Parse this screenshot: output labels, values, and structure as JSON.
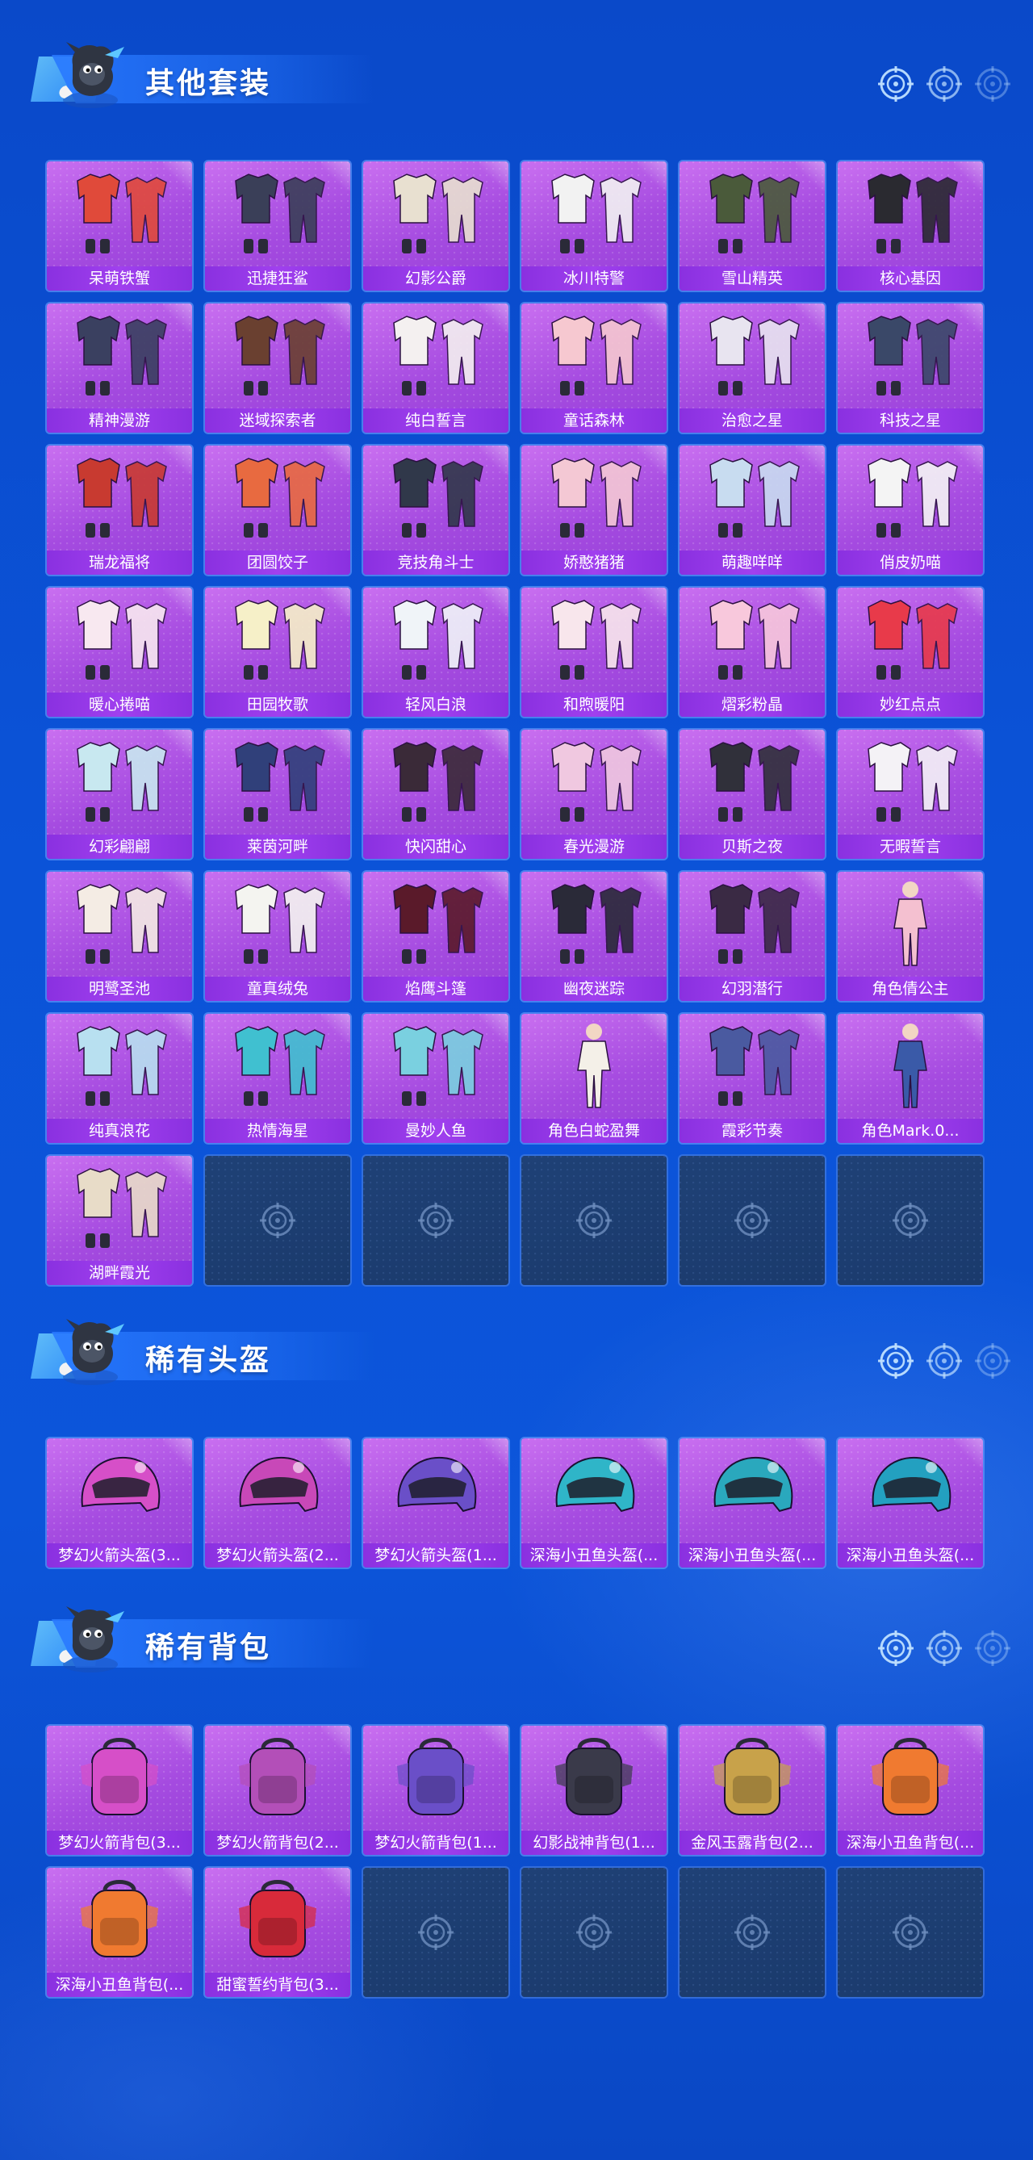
{
  "sections": [
    {
      "title": "其他套装",
      "items": [
        {
          "label": "呆萌铁蟹",
          "icon": "outfit-icon"
        },
        {
          "label": "迅捷狂鲨",
          "icon": "outfit-icon"
        },
        {
          "label": "幻影公爵",
          "icon": "outfit-icon"
        },
        {
          "label": "冰川特警",
          "icon": "outfit-icon"
        },
        {
          "label": "雪山精英",
          "icon": "outfit-icon"
        },
        {
          "label": "核心基因",
          "icon": "outfit-icon"
        },
        {
          "label": "精神漫游",
          "icon": "outfit-icon"
        },
        {
          "label": "迷域探索者",
          "icon": "outfit-icon"
        },
        {
          "label": "纯白誓言",
          "icon": "outfit-icon"
        },
        {
          "label": "童话森林",
          "icon": "outfit-icon"
        },
        {
          "label": "治愈之星",
          "icon": "outfit-icon"
        },
        {
          "label": "科技之星",
          "icon": "outfit-icon"
        },
        {
          "label": "瑞龙福将",
          "icon": "outfit-icon"
        },
        {
          "label": "团圆饺子",
          "icon": "outfit-icon"
        },
        {
          "label": "竞技角斗士",
          "icon": "outfit-icon"
        },
        {
          "label": "娇憨猪猪",
          "icon": "outfit-icon"
        },
        {
          "label": "萌趣咩咩",
          "icon": "outfit-icon"
        },
        {
          "label": "俏皮奶喵",
          "icon": "outfit-icon"
        },
        {
          "label": "暖心捲喵",
          "icon": "outfit-icon"
        },
        {
          "label": "田园牧歌",
          "icon": "outfit-icon"
        },
        {
          "label": "轻风白浪",
          "icon": "outfit-icon"
        },
        {
          "label": "和煦暖阳",
          "icon": "outfit-icon"
        },
        {
          "label": "熠彩粉晶",
          "icon": "outfit-icon"
        },
        {
          "label": "妙红点点",
          "icon": "outfit-icon"
        },
        {
          "label": "幻彩翩翩",
          "icon": "outfit-icon"
        },
        {
          "label": "莱茵河畔",
          "icon": "outfit-icon"
        },
        {
          "label": "快闪甜心",
          "icon": "outfit-icon"
        },
        {
          "label": "春光漫游",
          "icon": "outfit-icon"
        },
        {
          "label": "贝斯之夜",
          "icon": "outfit-icon"
        },
        {
          "label": "无暇誓言",
          "icon": "outfit-icon"
        },
        {
          "label": "明鹭圣池",
          "icon": "outfit-icon"
        },
        {
          "label": "童真绒兔",
          "icon": "outfit-icon"
        },
        {
          "label": "焰鹰斗篷",
          "icon": "outfit-icon"
        },
        {
          "label": "幽夜迷踪",
          "icon": "outfit-icon"
        },
        {
          "label": "幻羽潜行",
          "icon": "outfit-icon"
        },
        {
          "label": "角色倩公主",
          "icon": "character-icon"
        },
        {
          "label": "纯真浪花",
          "icon": "outfit-icon"
        },
        {
          "label": "热情海星",
          "icon": "outfit-icon"
        },
        {
          "label": "曼妙人鱼",
          "icon": "outfit-icon"
        },
        {
          "label": "角色白蛇盈舞",
          "icon": "character-icon"
        },
        {
          "label": "霞彩节奏",
          "icon": "outfit-icon"
        },
        {
          "label": "角色Mark.0...",
          "icon": "character-icon"
        },
        {
          "label": "湖畔霞光",
          "icon": "outfit-icon"
        }
      ],
      "empty_slots": 5
    },
    {
      "title": "稀有头盔",
      "items": [
        {
          "label": "梦幻火箭头盔(3...",
          "icon": "helmet-icon",
          "color": "#d64fc8"
        },
        {
          "label": "梦幻火箭头盔(2...",
          "icon": "helmet-icon",
          "color": "#c848b8"
        },
        {
          "label": "梦幻火箭头盔(1...",
          "icon": "helmet-icon",
          "color": "#6a4fc8"
        },
        {
          "label": "深海小丑鱼头盔(...",
          "icon": "helmet-icon",
          "color": "#2fb5c8"
        },
        {
          "label": "深海小丑鱼头盔(...",
          "icon": "helmet-icon",
          "color": "#2aa8bd"
        },
        {
          "label": "深海小丑鱼头盔(...",
          "icon": "helmet-icon",
          "color": "#23a0c0"
        }
      ],
      "empty_slots": 0
    },
    {
      "title": "稀有背包",
      "items": [
        {
          "label": "梦幻火箭背包(3...",
          "icon": "backpack-icon",
          "color": "#d64fc8"
        },
        {
          "label": "梦幻火箭背包(2...",
          "icon": "backpack-icon",
          "color": "#b34fb8"
        },
        {
          "label": "梦幻火箭背包(1...",
          "icon": "backpack-icon",
          "color": "#6a4fc8"
        },
        {
          "label": "幻影战神背包(1...",
          "icon": "backpack-icon",
          "color": "#3a3a4a"
        },
        {
          "label": "金风玉露背包(2...",
          "icon": "backpack-icon",
          "color": "#c8a24a"
        },
        {
          "label": "深海小丑鱼背包(...",
          "icon": "backpack-icon",
          "color": "#f07a30"
        },
        {
          "label": "深海小丑鱼背包(...",
          "icon": "backpack-icon",
          "color": "#f07a30"
        },
        {
          "label": "甜蜜誓约背包(3...",
          "icon": "backpack-icon",
          "color": "#d82a3a"
        }
      ],
      "empty_slots": 4
    }
  ],
  "colors": {
    "background": "#0b53d8",
    "card": "#a54be0",
    "label_bar": "#9a3ae8",
    "empty_card": "#1d3d70"
  }
}
